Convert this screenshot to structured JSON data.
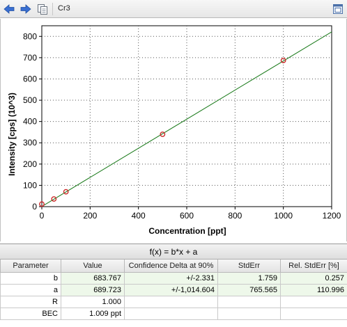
{
  "toolbar": {
    "title": "Cr3",
    "colors": {
      "back_arrow": "#3a6fd1",
      "forward_arrow": "#3a6fd1"
    }
  },
  "chart_data": {
    "type": "scatter",
    "xlabel": "Concentration [ppt]",
    "ylabel": "Intensity [cps] (10^3)",
    "xlim": [
      0,
      1200
    ],
    "ylim": [
      0,
      850
    ],
    "x_ticks": [
      0,
      200,
      400,
      600,
      800,
      1000,
      1200
    ],
    "y_ticks": [
      0,
      100,
      200,
      300,
      400,
      500,
      600,
      700,
      800
    ],
    "grid": true,
    "points": [
      {
        "x": 0,
        "y": 12
      },
      {
        "x": 50,
        "y": 36
      },
      {
        "x": 100,
        "y": 70
      },
      {
        "x": 500,
        "y": 340
      },
      {
        "x": 1000,
        "y": 687
      }
    ],
    "fit_line": {
      "slope": 0.6838,
      "intercept": 0.69
    },
    "colors": {
      "points": "#cc2a2a",
      "fit_line": "#1a7a1a",
      "grid": "#555555"
    }
  },
  "fit_table": {
    "title": "f(x) = b*x + a",
    "columns": [
      "Parameter",
      "Value",
      "Confidence Delta at 90%",
      "StdErr",
      "Rel. StdErr [%]"
    ],
    "rows": [
      {
        "parameter": "b",
        "value": "683.767",
        "confidence": "+/-2.331",
        "stderr": "1.759",
        "rel_stderr": "0.257"
      },
      {
        "parameter": "a",
        "value": "689.723",
        "confidence": "+/-1,014.604",
        "stderr": "765.565",
        "rel_stderr": "110.996"
      },
      {
        "parameter": "R",
        "value": "1.000",
        "confidence": "",
        "stderr": "",
        "rel_stderr": ""
      },
      {
        "parameter": "BEC",
        "value": "1.009 ppt",
        "confidence": "",
        "stderr": "",
        "rel_stderr": ""
      }
    ]
  }
}
